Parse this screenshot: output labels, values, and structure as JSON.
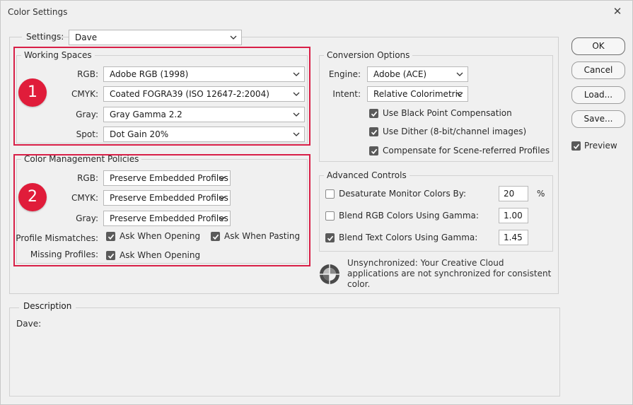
{
  "window": {
    "title": "Color Settings",
    "close_glyph": "✕"
  },
  "settings": {
    "label": "Settings:",
    "value": "Dave"
  },
  "working_spaces": {
    "legend": "Working Spaces",
    "rows": [
      {
        "label": "RGB:",
        "value": "Adobe RGB (1998)"
      },
      {
        "label": "CMYK:",
        "value": "Coated FOGRA39 (ISO 12647-2:2004)"
      },
      {
        "label": "Gray:",
        "value": "Gray Gamma 2.2"
      },
      {
        "label": "Spot:",
        "value": "Dot Gain 20%"
      }
    ]
  },
  "policies": {
    "legend": "Color Management Policies",
    "rows": [
      {
        "label": "RGB:",
        "value": "Preserve Embedded Profiles"
      },
      {
        "label": "CMYK:",
        "value": "Preserve Embedded Profiles"
      },
      {
        "label": "Gray:",
        "value": "Preserve Embedded Profiles"
      }
    ],
    "mismatch_label": "Profile Mismatches:",
    "ask_opening": "Ask When Opening",
    "ask_pasting": "Ask When Pasting",
    "missing_label": "Missing Profiles:",
    "missing_opening": "Ask When Opening"
  },
  "annotations": {
    "badge1": "1",
    "badge2": "2",
    "highlight_color": "#d81f47",
    "badge_color": "#e01c3a"
  },
  "conversion": {
    "legend": "Conversion Options",
    "engine_label": "Engine:",
    "engine_value": "Adobe (ACE)",
    "intent_label": "Intent:",
    "intent_value": "Relative Colorimetric",
    "opt_black_point": "Use Black Point Compensation",
    "opt_dither": "Use Dither (8-bit/channel images)",
    "opt_scene": "Compensate for Scene-referred Profiles"
  },
  "advanced": {
    "legend": "Advanced Controls",
    "desaturate_label": "Desaturate Monitor Colors By:",
    "desaturate_value": "20",
    "desaturate_unit": "%",
    "desaturate_checked": false,
    "blend_rgb_label": "Blend RGB Colors Using Gamma:",
    "blend_rgb_value": "1.00",
    "blend_rgb_checked": false,
    "blend_text_label": "Blend Text Colors Using Gamma:",
    "blend_text_value": "1.45",
    "blend_text_checked": true
  },
  "sync": {
    "icon": "color-sync-icon",
    "text": "Unsynchronized: Your Creative Cloud applications are not synchronized for consistent color."
  },
  "buttons": {
    "ok": "OK",
    "cancel": "Cancel",
    "load": "Load...",
    "save": "Save...",
    "preview": "Preview"
  },
  "description": {
    "legend": "Description",
    "text": "Dave:"
  }
}
